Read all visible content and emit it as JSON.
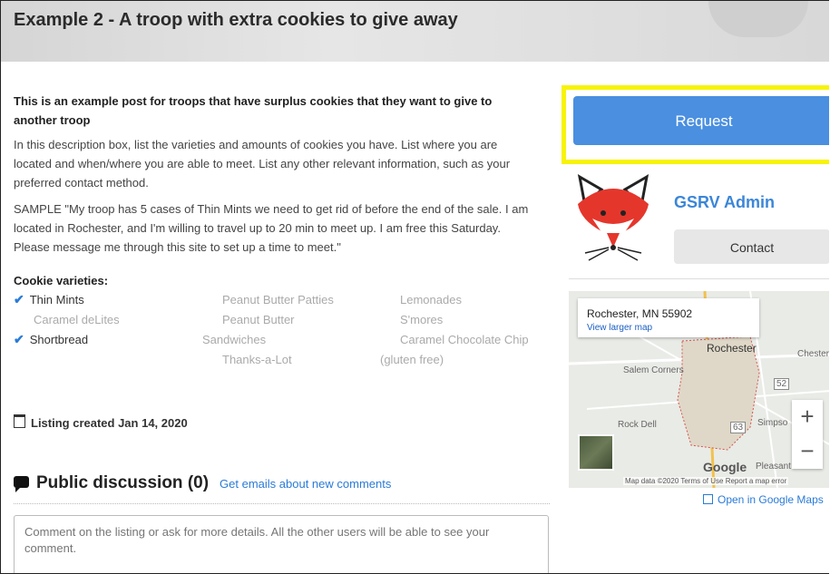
{
  "header": {
    "title": "Example 2 - A troop with extra cookies to give away"
  },
  "post": {
    "lead": "This is an example post for troops that have surplus cookies that they want to give to another troop",
    "para1": "In this description box, list the varieties and amounts of cookies you have. List where you are located and when/where you are able to meet. List any other relevant information, such as your preferred contact method.",
    "para2": "SAMPLE \"My troop has 5 cases of Thin Mints we need to get rid of before the end of the sale. I am located in Rochester, and I'm willing to travel up to 20 min to meet up. I am free this Saturday. Please message me through this site to set up a time to meet.\"",
    "varieties_label": "Cookie varieties:",
    "varieties": [
      {
        "label": "Thin Mints",
        "checked": true
      },
      {
        "label": "Peanut Butter Patties",
        "checked": false
      },
      {
        "label": "Lemonades",
        "checked": false
      },
      {
        "label": "Caramel deLites",
        "checked": false
      },
      {
        "label": "Peanut Butter",
        "checked": false
      },
      {
        "label": "S'mores",
        "checked": false
      },
      {
        "label": "Shortbread",
        "checked": true
      },
      {
        "label": "Sandwiches",
        "checked": false
      },
      {
        "label": "Caramel Chocolate Chip",
        "checked": false
      },
      {
        "label": "Thanks-a-Lot",
        "checked": false
      },
      {
        "label": "(gluten free)",
        "checked": false
      }
    ],
    "listing_created": "Listing created Jan 14, 2020"
  },
  "discussion": {
    "title": "Public discussion (0)",
    "emails_link": "Get emails about new comments",
    "comment_placeholder": "Comment on the listing or ask for more details. All the other users will be able to see your comment."
  },
  "sidebar": {
    "request_label": "Request",
    "author_name": "GSRV Admin",
    "contact_label": "Contact",
    "map": {
      "place": "Rochester, MN 55902",
      "larger_map": "View larger map",
      "labels": [
        "Rochester",
        "Salem Corners",
        "Rock Dell",
        "Simpso",
        "Chester",
        "Pleasant Grove",
        "52",
        "63"
      ],
      "google": "Google",
      "attribution": "Map data ©2020   Terms of Use   Report a map error"
    },
    "open_in_maps": "Open in Google Maps"
  },
  "colors": {
    "accent": "#4a8fe0",
    "highlight": "#f7f30d",
    "link": "#2a7bd8"
  }
}
